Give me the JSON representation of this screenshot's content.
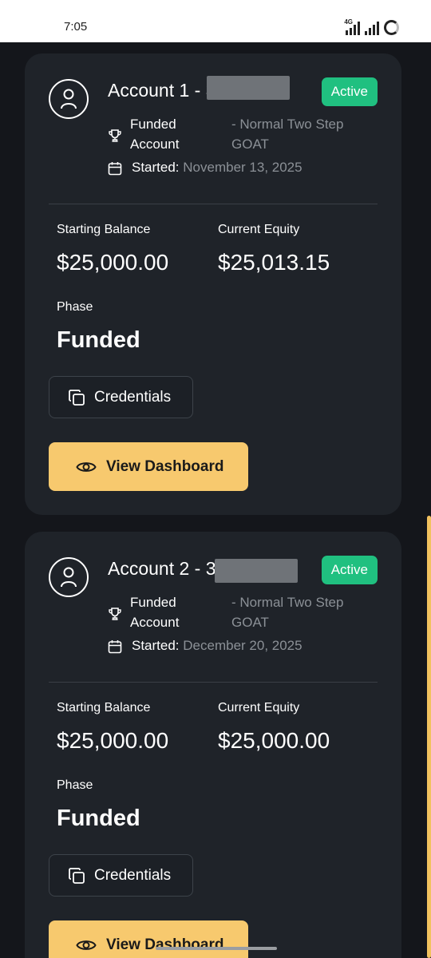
{
  "status_bar": {
    "time": "7:05",
    "network": "4G"
  },
  "accounts": [
    {
      "title": "Account 1 - 3",
      "status": "Active",
      "type_label": "Funded Account",
      "type_detail": "- Normal Two Step GOAT",
      "started_label": "Started:",
      "started_date": "November 13, 2025",
      "starting_balance_label": "Starting Balance",
      "starting_balance": "$25,000.00",
      "current_equity_label": "Current Equity",
      "current_equity": "$25,013.15",
      "phase_label": "Phase",
      "phase": "Funded",
      "credentials_label": "Credentials",
      "view_dashboard_label": "View Dashboard"
    },
    {
      "title": "Account 2 - 3",
      "status": "Active",
      "type_label": "Funded Account",
      "type_detail": "- Normal Two Step GOAT",
      "started_label": "Started:",
      "started_date": "December 20, 2025",
      "starting_balance_label": "Starting Balance",
      "starting_balance": "$25,000.00",
      "current_equity_label": "Current Equity",
      "current_equity": "$25,000.00",
      "phase_label": "Phase",
      "phase": "Funded",
      "credentials_label": "Credentials",
      "view_dashboard_label": "View Dashboard"
    }
  ],
  "colors": {
    "background": "#14161b",
    "card": "#1f2329",
    "active_badge": "#20c080",
    "primary_button": "#f7c96e",
    "muted_text": "#8b9096"
  }
}
